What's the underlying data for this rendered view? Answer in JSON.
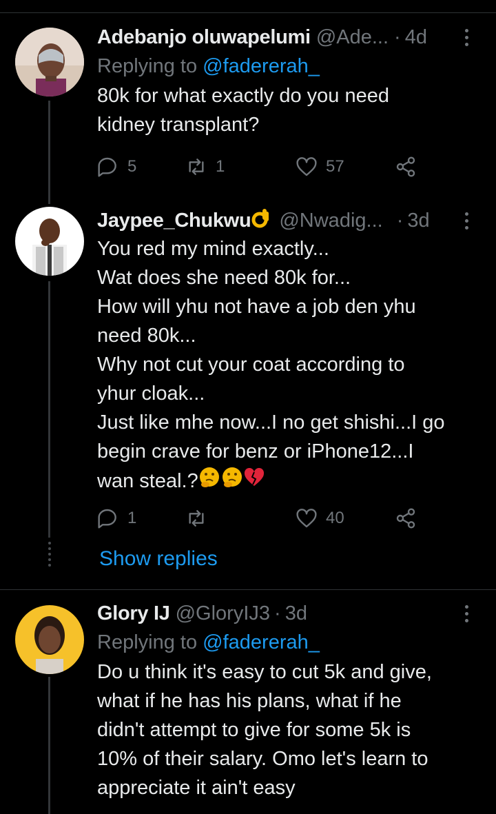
{
  "tweets": [
    {
      "name": "Adebanjo oluwapelumi",
      "handle": "@Ade...",
      "time": "4d",
      "replying_prefix": "Replying to ",
      "replying_to": "@fadererah_",
      "lines": [
        "80k for what exactly do you need",
        "kidney transplant?"
      ],
      "replies": "5",
      "retweets": "1",
      "likes": "57"
    },
    {
      "name": "Jaypee_Chukwu",
      "handle": "@Nwadig...",
      "time": "3d",
      "lines": [
        "You red my mind exactly...",
        "Wat does she need 80k for...",
        "How will yhu not have a job den yhu",
        "need 80k...",
        "Why not cut your coat according to",
        "yhur cloak...",
        "Just like mhe now...I no get shishi...I go",
        "begin crave for benz or iPhone12...I",
        "wan steal.?"
      ],
      "replies": "1",
      "retweets": "",
      "likes": "40"
    },
    {
      "name": "Glory IJ",
      "handle": "@GloryIJ3",
      "time": "3d",
      "replying_prefix": "Replying to ",
      "replying_to": "@fadererah_",
      "lines": [
        "Do u think it's easy to cut 5k and give,",
        "what if he has his plans, what if he",
        "didn't attempt to give for some 5k is",
        "10% of their salary. Omo let's learn to",
        "appreciate it ain't easy"
      ]
    }
  ],
  "show_replies": "Show replies",
  "icons": [
    "reply-icon",
    "retweet-icon",
    "like-icon",
    "share-icon",
    "more-icon",
    "ok-hand-emoji",
    "thinking-face-emoji",
    "broken-heart-emoji"
  ],
  "colors": {
    "background": "#000000",
    "text": "#e8eaeb",
    "secondary": "#71767b",
    "link": "#1d9bf0",
    "divider": "#2f3336"
  }
}
